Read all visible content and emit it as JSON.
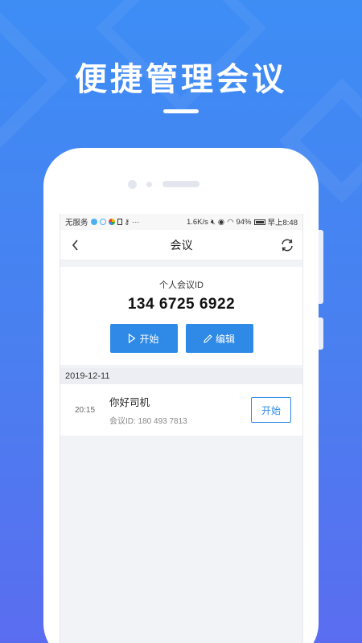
{
  "promo": {
    "headline": "便捷管理会议"
  },
  "status_bar": {
    "carrier": "无服务",
    "extra": "···",
    "speed": "1.6K/s",
    "battery": "94%",
    "time": "早上8:48"
  },
  "nav": {
    "title": "会议",
    "back_icon": "chevron-left-icon",
    "refresh_icon": "refresh-icon"
  },
  "personal_meeting": {
    "label": "个人会议ID",
    "id": "134 6725 6922",
    "start_label": "开始",
    "edit_label": "编辑"
  },
  "meetings": {
    "date": "2019-12-11",
    "items": [
      {
        "time": "20:15",
        "name": "你好司机",
        "id_text": "会议ID: 180 493 7813",
        "action_label": "开始"
      }
    ]
  },
  "colors": {
    "accent": "#2e8ae6",
    "background_top": "#3d8df5",
    "background_bottom": "#5a6df0"
  }
}
